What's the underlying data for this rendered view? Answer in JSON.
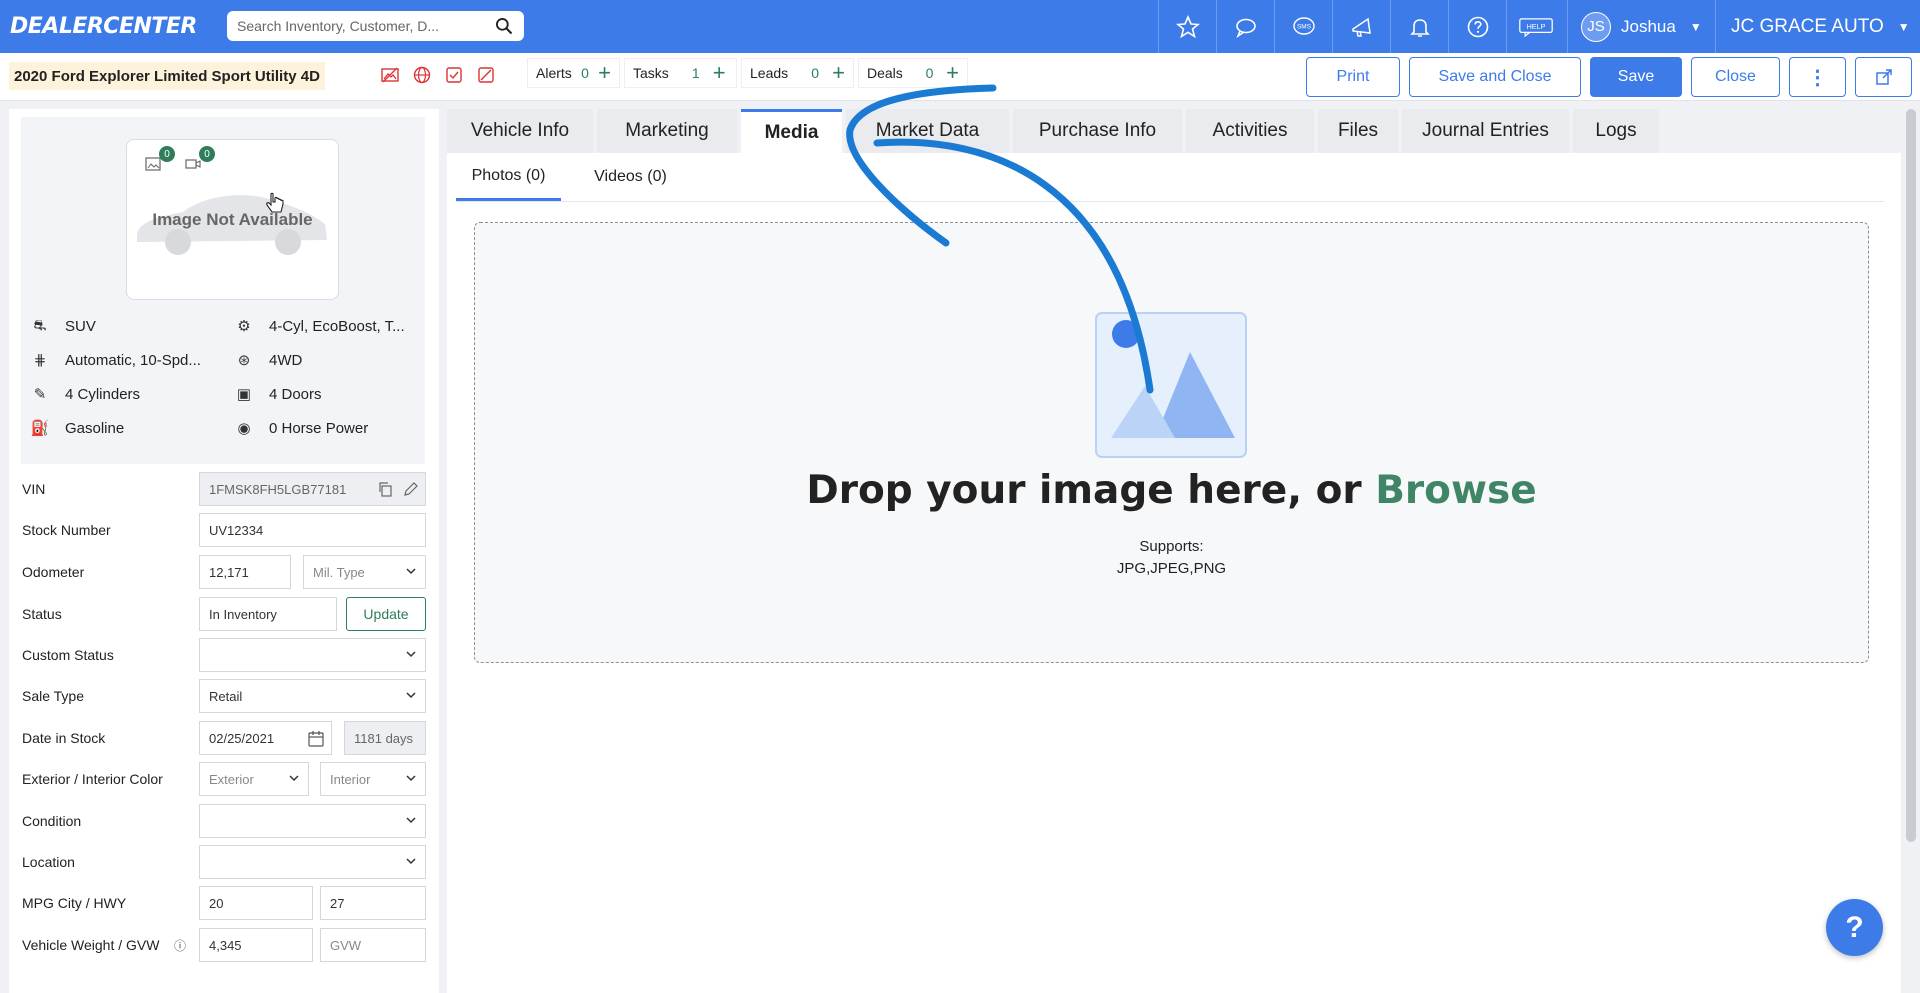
{
  "app": {
    "logo": "DEALERCENTER"
  },
  "search": {
    "placeholder": "Search Inventory, Customer, D..."
  },
  "nav": {
    "icons": [
      "star-icon",
      "chat-icon",
      "sms-icon",
      "megaphone-icon",
      "bell-icon",
      "question-icon",
      "help-icon"
    ],
    "sms_label": "SMS",
    "help_label": "HELP",
    "user_initials": "JS",
    "user_name": "Joshua",
    "dealer_name": "JC GRACE AUTO"
  },
  "vehicle": {
    "title": "2020 Ford Explorer Limited Sport Utility 4D"
  },
  "counters": [
    {
      "label": "Alerts",
      "value": "0"
    },
    {
      "label": "Tasks",
      "value": "1"
    },
    {
      "label": "Leads",
      "value": "0"
    },
    {
      "label": "Deals",
      "value": "0"
    }
  ],
  "actions": {
    "print": "Print",
    "save_close": "Save and Close",
    "save": "Save",
    "close": "Close"
  },
  "image": {
    "not_available": "Image Not Available",
    "photo_count": "0",
    "video_count": "0"
  },
  "specs": [
    {
      "icon": "car-icon",
      "text": "SUV"
    },
    {
      "icon": "engine-icon",
      "text": "4-Cyl, EcoBoost, T..."
    },
    {
      "icon": "transmission-icon",
      "text": "Automatic, 10-Spd..."
    },
    {
      "icon": "drivetrain-icon",
      "text": "4WD"
    },
    {
      "icon": "cylinder-icon",
      "text": "4 Cylinders"
    },
    {
      "icon": "door-icon",
      "text": "4 Doors"
    },
    {
      "icon": "fuel-icon",
      "text": "Gasoline"
    },
    {
      "icon": "horsepower-icon",
      "text": "0 Horse Power"
    }
  ],
  "form": {
    "vin_label": "VIN",
    "vin": "1FMSK8FH5LGB77181",
    "stock_label": "Stock Number",
    "stock": "UV12334",
    "odometer_label": "Odometer",
    "odometer": "12,171",
    "mil_type": "Mil. Type",
    "status_label": "Status",
    "status": "In Inventory",
    "update": "Update",
    "custom_status_label": "Custom Status",
    "custom_status": "",
    "sale_type_label": "Sale Type",
    "sale_type": "Retail",
    "date_label": "Date in Stock",
    "date": "02/25/2021",
    "days": "1181 days",
    "color_label": "Exterior / Interior Color",
    "exterior": "Exterior",
    "interior": "Interior",
    "condition_label": "Condition",
    "condition": "",
    "location_label": "Location",
    "location": "",
    "mpg_label": "MPG City / HWY",
    "mpg_city": "20",
    "mpg_hwy": "27",
    "weight_label": "Vehicle Weight / GVW",
    "weight": "4,345",
    "gvw": "GVW"
  },
  "tabs": [
    "Vehicle Info",
    "Marketing",
    "Media",
    "Market Data",
    "Purchase Info",
    "Activities",
    "Files",
    "Journal Entries",
    "Logs"
  ],
  "active_tab": "Media",
  "subtabs": [
    "Photos (0)",
    "Videos (0)"
  ],
  "dropzone": {
    "text": "Drop your image here, or",
    "browse": "Browse",
    "supports": "Supports:",
    "formats": "JPG,JPEG,PNG"
  },
  "help_fab": "?",
  "colors": {
    "primary": "#3d7be8",
    "green": "#2e7d5b",
    "browse": "#3f8566",
    "annotation": "#1b7bd3"
  }
}
